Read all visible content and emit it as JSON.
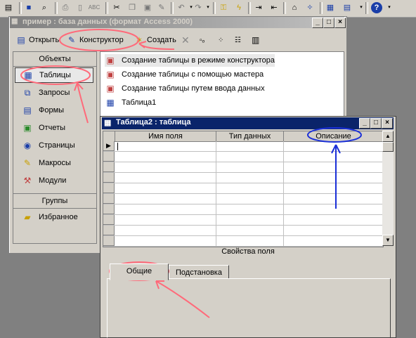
{
  "toolbar": {
    "icons": [
      "new-doc-icon",
      "save-icon",
      "search-icon",
      "print-icon",
      "print-preview-icon",
      "spelling-icon",
      "cut-icon",
      "copy-icon",
      "paste-icon",
      "format-painter-icon",
      "undo-icon",
      "redo-icon",
      "key-icon",
      "lightning-icon",
      "insert-rows-icon",
      "delete-rows-icon",
      "properties-icon",
      "build-icon",
      "database-window-icon",
      "new-object-icon",
      "help-icon"
    ]
  },
  "db_window": {
    "title": "пример : база данных (формат Access 2000)",
    "tools": {
      "open": "Открыть",
      "design": "Конструктор",
      "create": "Создать"
    },
    "objects_header": "Объекты",
    "nav": [
      {
        "label": "Таблицы",
        "icon": "table-icon"
      },
      {
        "label": "Запросы",
        "icon": "query-icon"
      },
      {
        "label": "Формы",
        "icon": "form-icon"
      },
      {
        "label": "Отчеты",
        "icon": "report-icon"
      },
      {
        "label": "Страницы",
        "icon": "page-icon"
      },
      {
        "label": "Макросы",
        "icon": "macro-icon"
      },
      {
        "label": "Модули",
        "icon": "module-icon"
      }
    ],
    "groups_header": "Группы",
    "groups": [
      {
        "label": "Избранное",
        "icon": "favorites-folder-icon"
      }
    ],
    "list": [
      "Создание таблицы в режиме конструктора",
      "Создание таблицы с помощью мастера",
      "Создание таблицы путем ввода данных",
      "Таблица1"
    ]
  },
  "design_window": {
    "title": "Таблица2 : таблица",
    "columns": [
      "Имя поля",
      "Тип данных",
      "Описание"
    ],
    "props_label": "Свойства поля",
    "tabs": [
      "Общие",
      "Подстановка"
    ]
  },
  "colors": {
    "titlebar_active": "#0a246a",
    "titlebar_inactive": "#808080",
    "annotation_red": "#ff6a7a",
    "annotation_blue": "#1a2fd8"
  }
}
